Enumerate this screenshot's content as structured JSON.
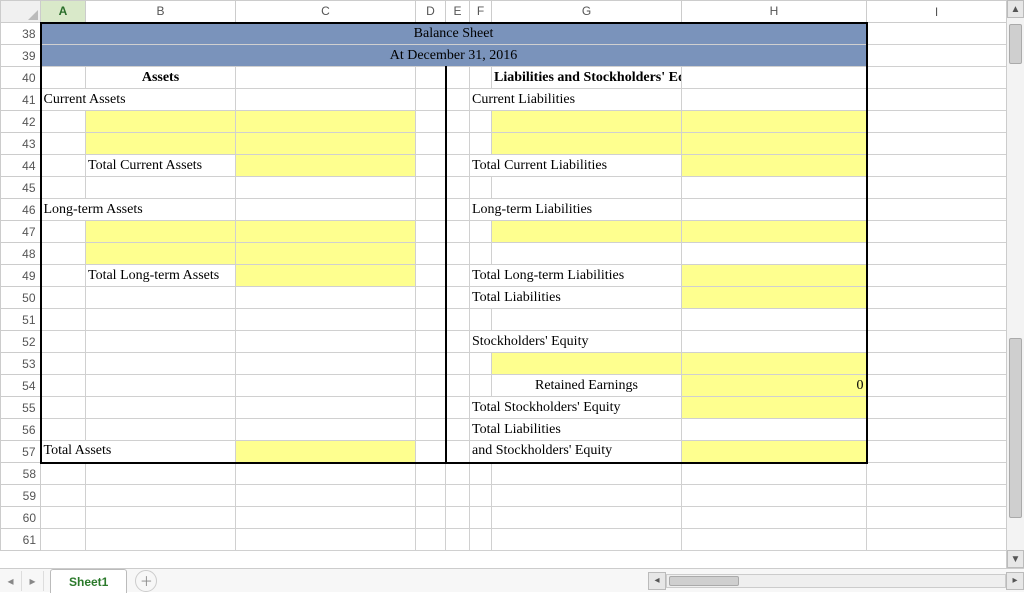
{
  "columns": [
    "A",
    "B",
    "C",
    "D",
    "E",
    "F",
    "G",
    "H",
    "I"
  ],
  "active_column": "A",
  "row_start": 38,
  "row_end": 61,
  "titles": {
    "balance_sheet": "Balance Sheet",
    "date": "At December 31, 2016",
    "assets": "Assets",
    "liab_equity": "Liabilities and Stockholders' Equity"
  },
  "labels": {
    "current_assets": "Current Assets",
    "total_current_assets": "Total Current Assets",
    "long_term_assets": "Long-term Assets",
    "total_long_term_assets": "Total Long-term Assets",
    "total_assets": "Total Assets",
    "current_liabilities": "Current Liabilities",
    "total_current_liabilities": "Total Current Liabilities",
    "long_term_liabilities": "Long-term Liabilities",
    "total_long_term_liabilities": "Total Long-term Liabilities",
    "total_liabilities": "Total Liabilities",
    "stockholders_equity": "Stockholders' Equity",
    "retained_earnings": "Retained Earnings",
    "total_stockholders_equity": "Total Stockholders' Equity",
    "total_liab_and_equity_1": "Total Liabilities",
    "total_liab_and_equity_2": "and Stockholders' Equity"
  },
  "values": {
    "retained_earnings": "0"
  },
  "sheet_tab": "Sheet1",
  "col_widths": {
    "A": 45,
    "B": 150,
    "C": 180,
    "D": 30,
    "E": 24,
    "F": 22,
    "G": 190,
    "H": 185,
    "I": 60
  }
}
